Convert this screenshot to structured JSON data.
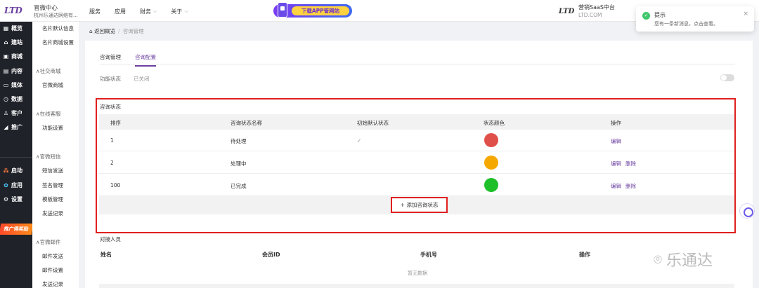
{
  "header": {
    "logo": "LTD",
    "brand_title": "官微中心",
    "brand_sub": "杭州乐通达网络有...",
    "nav": [
      {
        "label": "服务"
      },
      {
        "label": "应用"
      },
      {
        "label": "财务"
      },
      {
        "label": "关于"
      }
    ],
    "banner_text": "下载APP管网站",
    "right_logo": "LTD",
    "saas_title": "营销SaaS中台",
    "saas_sub": "LTD.COM"
  },
  "notification": {
    "title": "提示",
    "message": "您有一条新消息，点击查看。"
  },
  "sidebar": {
    "items": [
      {
        "label": "概览",
        "icon": "grid-icon"
      },
      {
        "label": "建站",
        "icon": "home-icon"
      },
      {
        "label": "商城",
        "icon": "shop-icon"
      },
      {
        "label": "内容",
        "icon": "document-icon"
      },
      {
        "label": "媒体",
        "icon": "media-icon"
      },
      {
        "label": "数据",
        "icon": "clock-icon"
      },
      {
        "label": "客户",
        "icon": "user-icon"
      },
      {
        "label": "推广",
        "icon": "promote-icon"
      }
    ],
    "bottom": [
      {
        "label": "启动",
        "icon": "launch-icon"
      },
      {
        "label": "应用",
        "icon": "apps-icon"
      },
      {
        "label": "设置",
        "icon": "gear-icon"
      }
    ],
    "promo": "推广得奖励"
  },
  "subsidebar": {
    "items_top": [
      "名片默认信息",
      "名片商城设置"
    ],
    "group1": "社交商城",
    "group1_items": [
      "官微商城"
    ],
    "group2": "在线客服",
    "group2_items": [
      "功能设置"
    ],
    "group3": "官微短信",
    "group3_items": [
      "短信发送",
      "签名管理",
      "模板管理",
      "发送记录"
    ],
    "group4": "官微邮件",
    "group4_items": [
      "邮件发送",
      "邮件设置",
      "发送记录"
    ]
  },
  "breadcrumb": {
    "back": "返回概览",
    "current": "咨询管理"
  },
  "tabs": [
    {
      "label": "咨询管理"
    },
    {
      "label": "咨询配置"
    }
  ],
  "function": {
    "label": "功能状态",
    "value": "已关闭"
  },
  "status_section": {
    "title": "咨询状态",
    "headers": [
      "排序",
      "咨询状态名称",
      "初始默认状态",
      "状态颜色",
      "操作"
    ],
    "rows": [
      {
        "order": "1",
        "name": "待处理",
        "default": "✓",
        "color": "#e0504a",
        "actions": [
          "编辑"
        ]
      },
      {
        "order": "2",
        "name": "处理中",
        "default": "",
        "color": "#f5a800",
        "actions": [
          "编辑",
          "删除"
        ]
      },
      {
        "order": "100",
        "name": "已完成",
        "default": "",
        "color": "#1fbf2a",
        "actions": [
          "编辑",
          "删除"
        ]
      }
    ],
    "add_button": "+ 添加咨询状态"
  },
  "contact_section": {
    "title": "对接人员",
    "headers": [
      "姓名",
      "会员ID",
      "手机号",
      "操作"
    ],
    "empty_text": "暂无数据"
  },
  "watermark": "乐通达"
}
